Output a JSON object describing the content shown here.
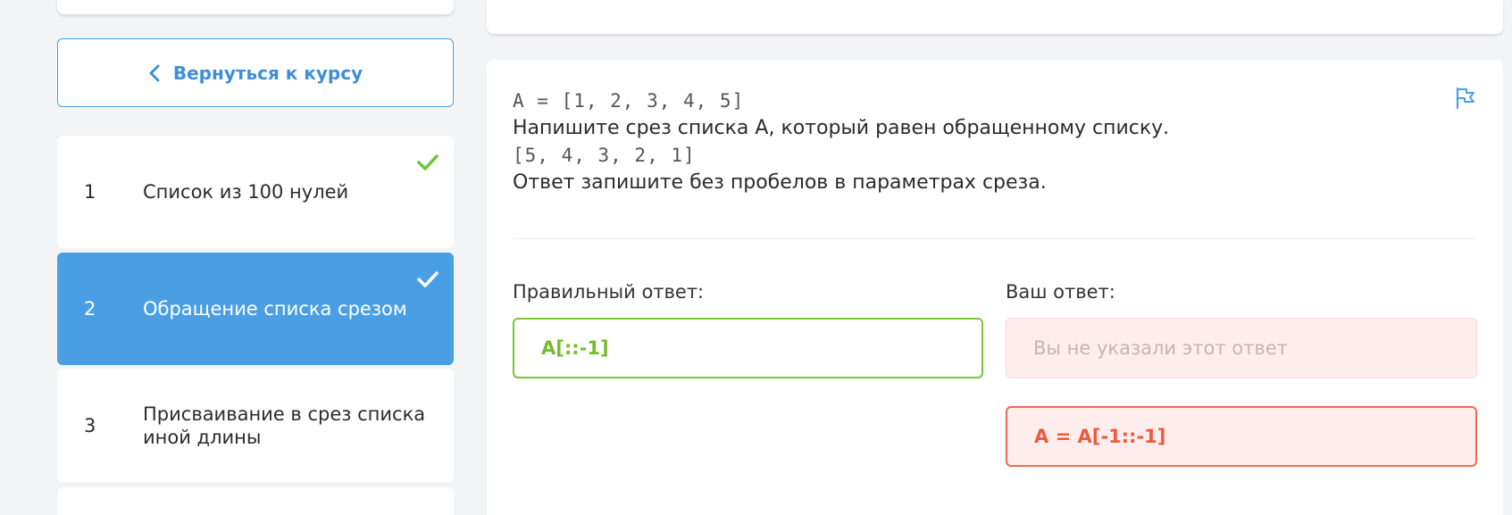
{
  "sidebar": {
    "back_label": "Вернуться к курсу",
    "lessons": [
      {
        "num": "1",
        "title": "Список из 100 нулей",
        "done": true
      },
      {
        "num": "2",
        "title": "Обращение списка срезом",
        "done": true,
        "active": true
      },
      {
        "num": "3",
        "title": "Присваивание в срез списка иной длины",
        "done": false
      }
    ]
  },
  "task": {
    "code_1": "A = [1, 2, 3, 4, 5]",
    "text_1": "Напишите срез списка A, который равен обращенному списку.",
    "code_2": "[5, 4, 3, 2, 1]",
    "text_2": "Ответ запишите без пробелов в параметрах среза."
  },
  "answers": {
    "correct_label": "Правильный ответ:",
    "correct_value": "A[::-1]",
    "yours_label": "Ваш ответ:",
    "yours_empty": "Вы не указали этот ответ",
    "yours_value": "A = A[-1::-1]"
  },
  "colors": {
    "accent_blue": "#4a9fe4",
    "success_green": "#7cc537",
    "error_red": "#f06a4e"
  },
  "icons": [
    "chevron-left-icon",
    "checkmark-icon",
    "flag-icon"
  ]
}
